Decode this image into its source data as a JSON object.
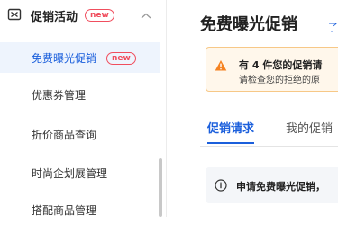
{
  "sidebar": {
    "group": {
      "label": "促销活动",
      "badge": "new",
      "icon": "promotion-icon",
      "chevron": "chevron-up-icon"
    },
    "items": [
      {
        "label": "免费曝光促销",
        "badge": "new",
        "active": true
      },
      {
        "label": "优惠券管理"
      },
      {
        "label": "折价商品查询"
      },
      {
        "label": "时尚企划展管理"
      },
      {
        "label": "搭配商品管理"
      }
    ]
  },
  "main": {
    "title": "免费曝光促销",
    "title_suffix": "了",
    "alert": {
      "line1": "有 4 件您的促销请",
      "line2": "请检查您的拒绝的原",
      "icon": "warning-icon",
      "color": "#f58220"
    },
    "tabs": [
      {
        "label": "促销请求",
        "active": true
      },
      {
        "label": "我的促销"
      }
    ],
    "info": {
      "text": "申请免费曝光促销，",
      "icon": "info-icon"
    }
  },
  "colors": {
    "accent": "#1b5fdc",
    "badge": "#f04e5e",
    "active_bg": "#eef4fd"
  }
}
